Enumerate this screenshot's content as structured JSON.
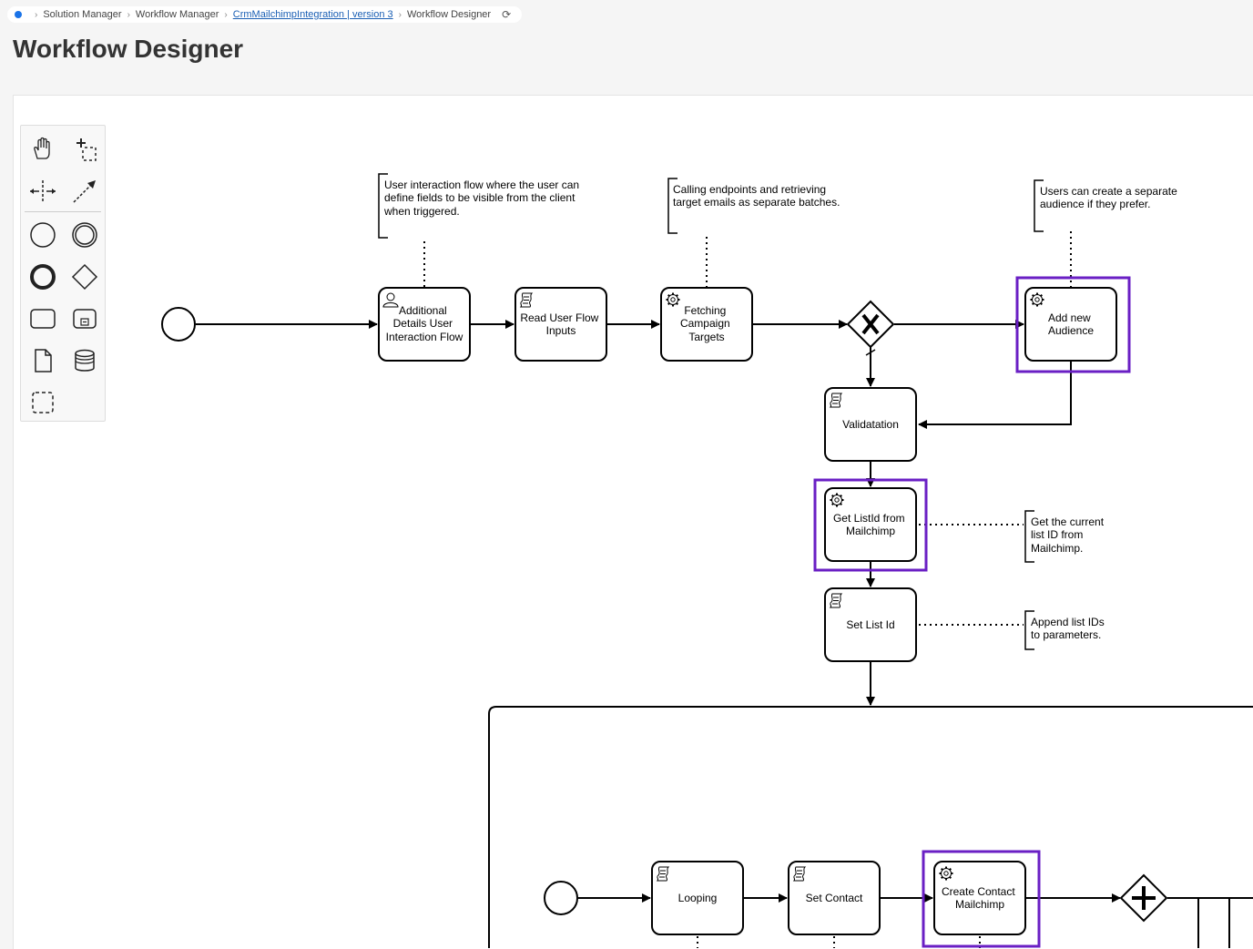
{
  "breadcrumb": {
    "items": [
      {
        "label": "Solution Manager"
      },
      {
        "label": "Workflow Manager"
      },
      {
        "label": "CrmMailchimpIntegration | version 3"
      },
      {
        "label": "Workflow Designer"
      }
    ]
  },
  "page": {
    "title": "Workflow Designer"
  },
  "palette": {
    "tools": [
      {
        "name": "hand-tool-icon"
      },
      {
        "name": "lasso-tool-icon"
      },
      {
        "name": "space-tool-icon"
      },
      {
        "name": "connect-tool-icon"
      },
      {
        "name": "start-event-icon"
      },
      {
        "name": "intermediate-event-icon"
      },
      {
        "name": "end-event-icon"
      },
      {
        "name": "gateway-icon"
      },
      {
        "name": "task-icon"
      },
      {
        "name": "subprocess-icon"
      },
      {
        "name": "data-object-icon"
      },
      {
        "name": "data-store-icon"
      },
      {
        "name": "group-icon"
      }
    ]
  },
  "diagram": {
    "tasks": [
      {
        "id": "t1",
        "lines": [
          "Additional",
          "Details User",
          "Interaction Flow"
        ],
        "icon": "user-task-icon"
      },
      {
        "id": "t2",
        "lines": [
          "Read User Flow",
          "Inputs"
        ],
        "icon": "script-task-icon"
      },
      {
        "id": "t3",
        "lines": [
          "Fetching",
          "Campaign",
          "Targets"
        ],
        "icon": "service-task-icon"
      },
      {
        "id": "t4",
        "lines": [
          "Add new",
          "Audience"
        ],
        "icon": "service-task-icon"
      },
      {
        "id": "t5",
        "lines": [
          "Validatation"
        ],
        "icon": "script-task-icon"
      },
      {
        "id": "t6",
        "lines": [
          "Get ListId from",
          "Mailchimp"
        ],
        "icon": "service-task-icon"
      },
      {
        "id": "t7",
        "lines": [
          "Set List Id"
        ],
        "icon": "script-task-icon"
      },
      {
        "id": "t8",
        "lines": [
          "Looping"
        ],
        "icon": "script-task-icon"
      },
      {
        "id": "t9",
        "lines": [
          "Set Contact"
        ],
        "icon": "script-task-icon"
      },
      {
        "id": "t10",
        "lines": [
          "Create Contact",
          "Mailchimp"
        ],
        "icon": "service-task-icon"
      }
    ],
    "annotations": [
      {
        "id": "a1",
        "lines": [
          "User interaction flow where the user can",
          "define fields to be visible from the client",
          "when triggered."
        ]
      },
      {
        "id": "a2",
        "lines": [
          "Calling endpoints and retrieving",
          "target emails as separate batches."
        ]
      },
      {
        "id": "a3",
        "lines": [
          "Users can create a separate",
          "audience if they prefer."
        ]
      },
      {
        "id": "a4",
        "lines": [
          "Get the current",
          "list ID from",
          "Mailchimp."
        ]
      },
      {
        "id": "a5",
        "lines": [
          "Append list IDs",
          "to parameters."
        ]
      }
    ],
    "highlight_color": "#6a1fc4"
  }
}
